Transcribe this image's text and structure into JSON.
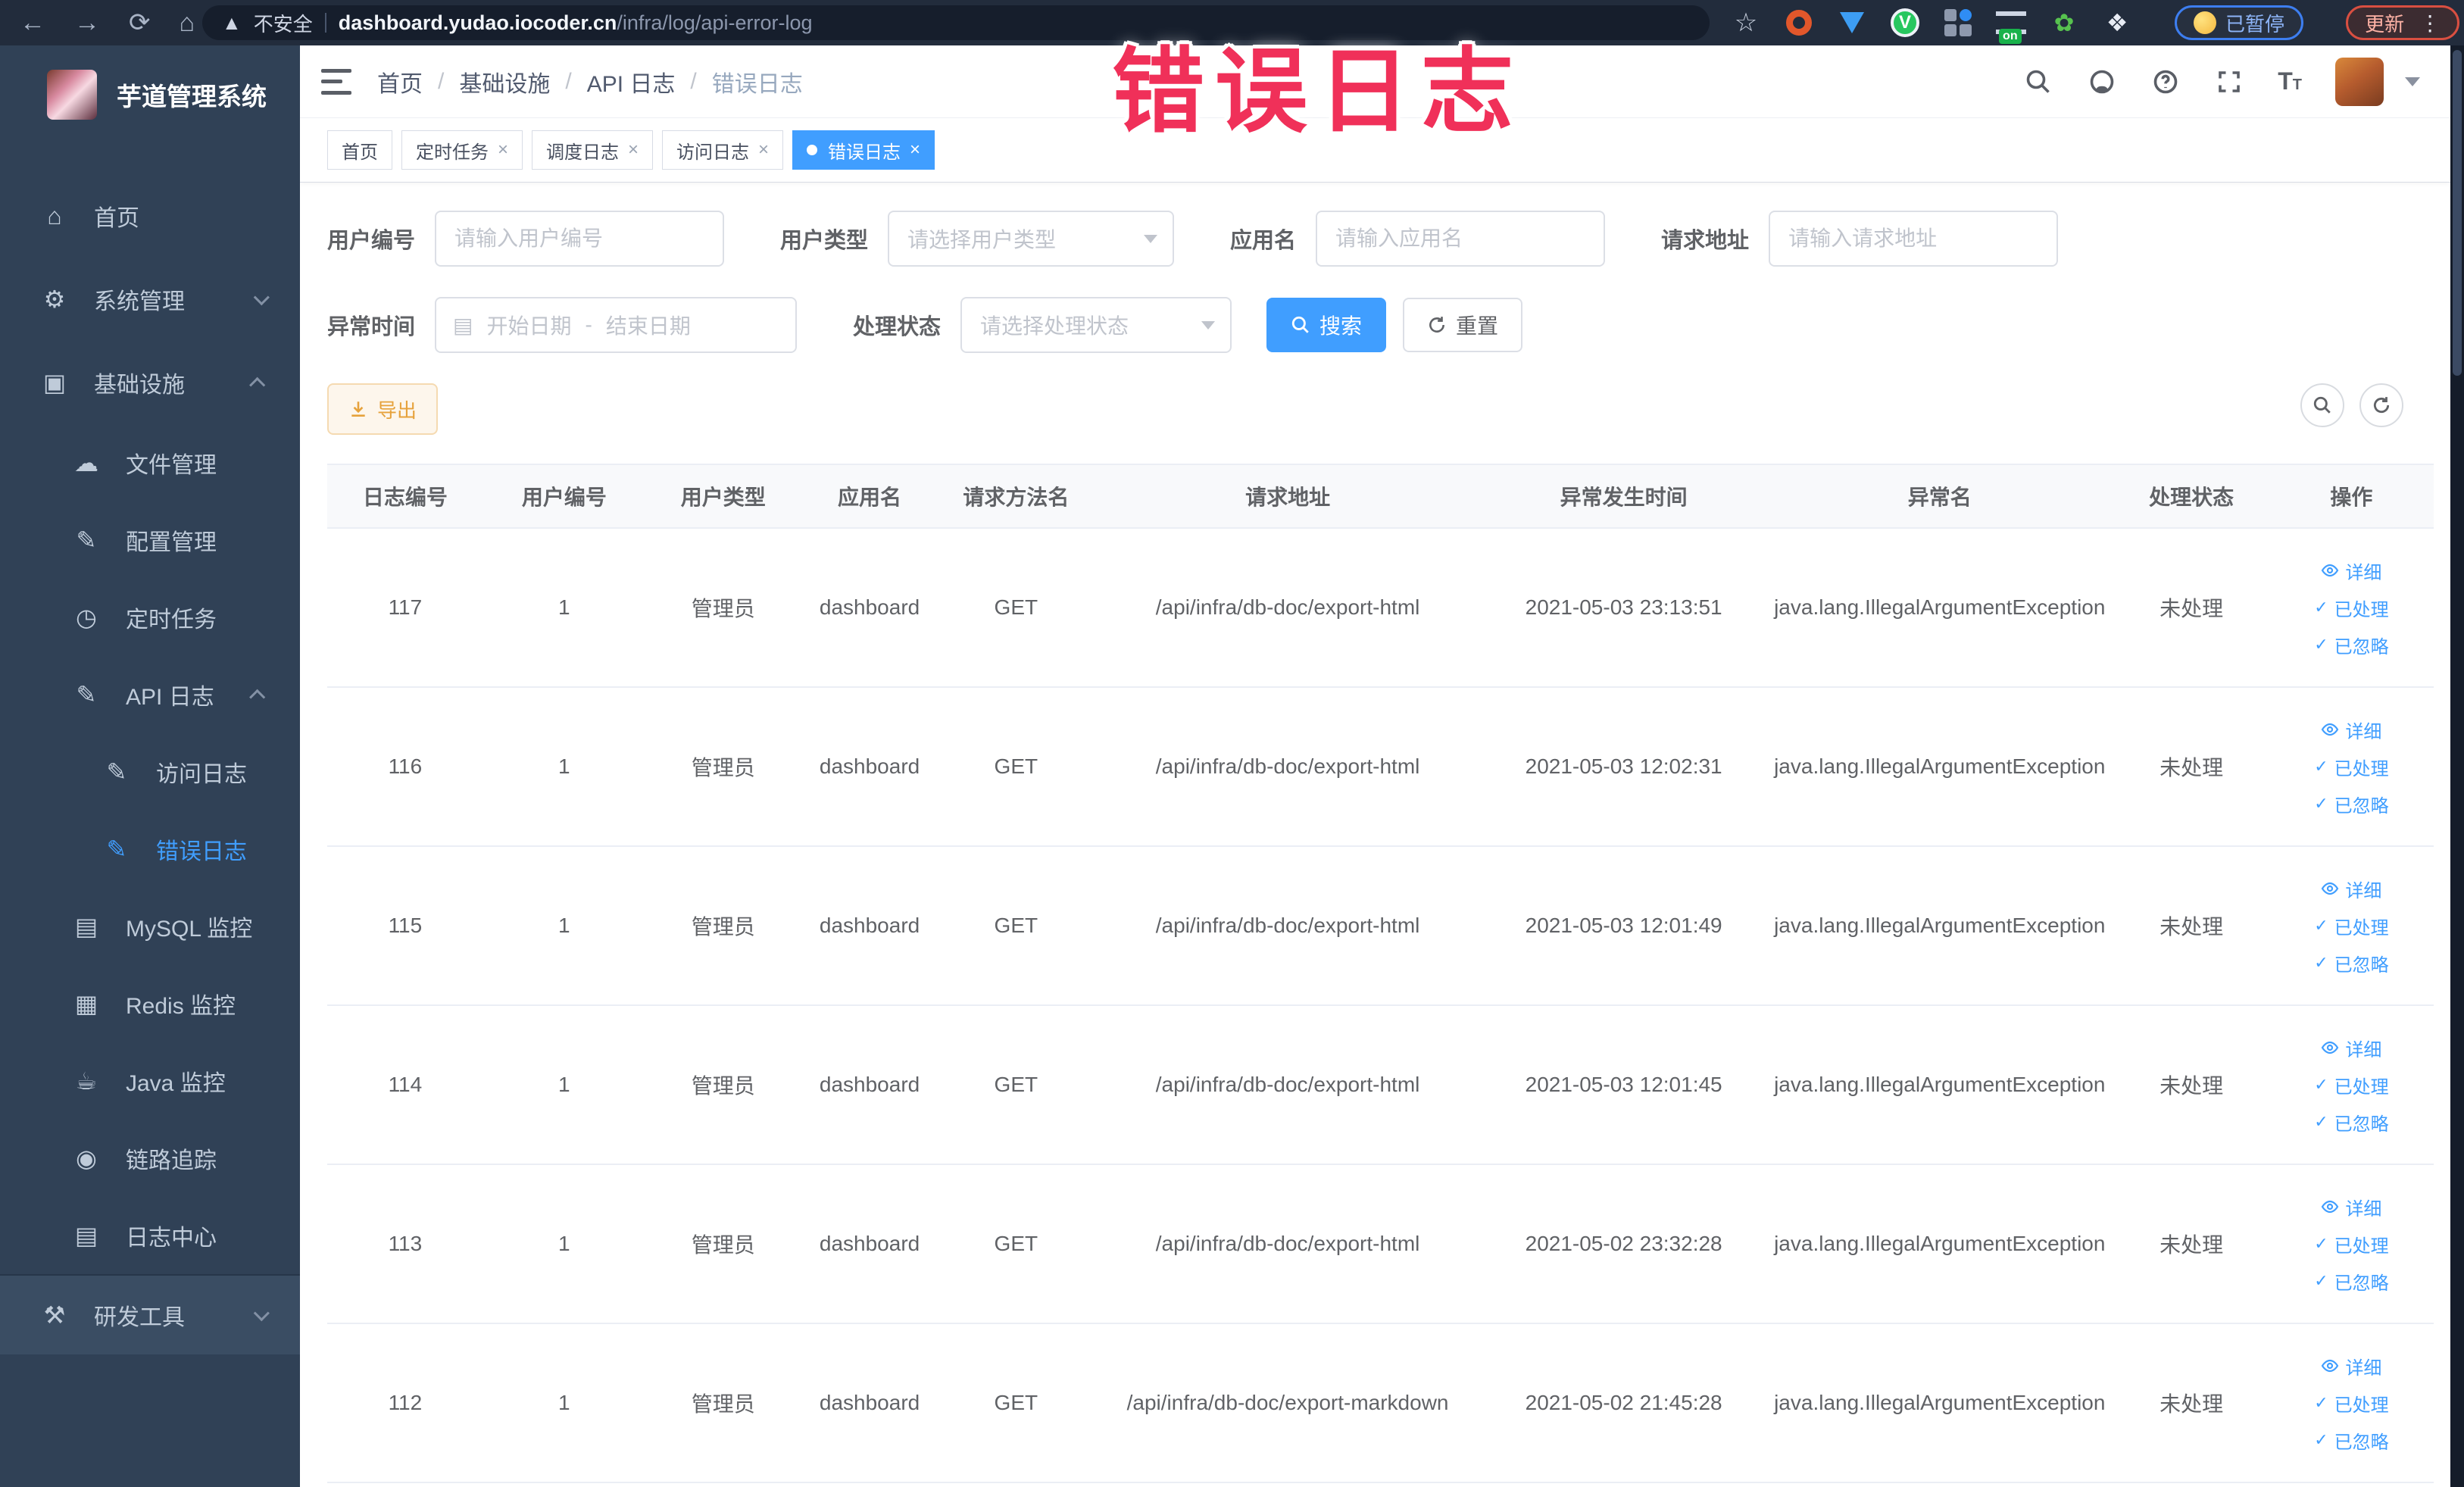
{
  "annotation": {
    "text": "错误日志"
  },
  "ui": {
    "close": "×",
    "crumb_sep": "/",
    "kebab": "⋮",
    "grid_v": "V",
    "on_badge": "on"
  },
  "browser": {
    "security_label": "不安全",
    "url_domain": "dashboard.yudao.iocoder.cn",
    "url_path": "/infra/log/api-error-log",
    "paused_badge": "已暂停",
    "update_badge": "更新"
  },
  "sidebar": {
    "title": "芋道管理系统",
    "menu": [
      {
        "label": "首页"
      },
      {
        "label": "系统管理"
      },
      {
        "label": "基础设施"
      },
      {
        "label": "文件管理"
      },
      {
        "label": "配置管理"
      },
      {
        "label": "定时任务"
      },
      {
        "label": "API 日志"
      },
      {
        "label": "访问日志"
      },
      {
        "label": "错误日志"
      },
      {
        "label": "MySQL 监控"
      },
      {
        "label": "Redis 监控"
      },
      {
        "label": "Java 监控"
      },
      {
        "label": "链路追踪"
      },
      {
        "label": "日志中心"
      },
      {
        "label": "研发工具"
      }
    ]
  },
  "navbar": {
    "breadcrumb": [
      "首页",
      "基础设施",
      "API 日志",
      "错误日志"
    ]
  },
  "tabs": [
    {
      "label": "首页"
    },
    {
      "label": "定时任务"
    },
    {
      "label": "调度日志"
    },
    {
      "label": "访问日志"
    },
    {
      "label": "错误日志"
    }
  ],
  "filters": {
    "user_id_label": "用户编号",
    "user_id_placeholder": "请输入用户编号",
    "user_type_label": "用户类型",
    "user_type_placeholder": "请选择用户类型",
    "app_name_label": "应用名",
    "app_name_placeholder": "请输入应用名",
    "request_url_label": "请求地址",
    "request_url_placeholder": "请输入请求地址",
    "exception_time_label": "异常时间",
    "date_start_placeholder": "开始日期",
    "date_separator": "-",
    "date_end_placeholder": "结束日期",
    "process_status_label": "处理状态",
    "process_status_placeholder": "请选择处理状态",
    "search_button": "搜索",
    "reset_button": "重置"
  },
  "toolbar": {
    "export_button": "导出"
  },
  "table": {
    "columns": [
      "日志编号",
      "用户编号",
      "用户类型",
      "应用名",
      "请求方法名",
      "请求地址",
      "异常发生时间",
      "异常名",
      "处理状态",
      "操作"
    ],
    "actions": {
      "detail": "详细",
      "processed": "已处理",
      "ignored": "已忽略"
    },
    "rows": [
      {
        "id": "117",
        "user_id": "1",
        "user_type": "管理员",
        "app": "dashboard",
        "method": "GET",
        "url": "/api/infra/db-doc/export-html",
        "time": "2021-05-03 23:13:51",
        "exception": "java.lang.IllegalArgumentException",
        "status": "未处理"
      },
      {
        "id": "116",
        "user_id": "1",
        "user_type": "管理员",
        "app": "dashboard",
        "method": "GET",
        "url": "/api/infra/db-doc/export-html",
        "time": "2021-05-03 12:02:31",
        "exception": "java.lang.IllegalArgumentException",
        "status": "未处理"
      },
      {
        "id": "115",
        "user_id": "1",
        "user_type": "管理员",
        "app": "dashboard",
        "method": "GET",
        "url": "/api/infra/db-doc/export-html",
        "time": "2021-05-03 12:01:49",
        "exception": "java.lang.IllegalArgumentException",
        "status": "未处理"
      },
      {
        "id": "114",
        "user_id": "1",
        "user_type": "管理员",
        "app": "dashboard",
        "method": "GET",
        "url": "/api/infra/db-doc/export-html",
        "time": "2021-05-03 12:01:45",
        "exception": "java.lang.IllegalArgumentException",
        "status": "未处理"
      },
      {
        "id": "113",
        "user_id": "1",
        "user_type": "管理员",
        "app": "dashboard",
        "method": "GET",
        "url": "/api/infra/db-doc/export-html",
        "time": "2021-05-02 23:32:28",
        "exception": "java.lang.IllegalArgumentException",
        "status": "未处理"
      },
      {
        "id": "112",
        "user_id": "1",
        "user_type": "管理员",
        "app": "dashboard",
        "method": "GET",
        "url": "/api/infra/db-doc/export-markdown",
        "time": "2021-05-02 21:45:28",
        "exception": "java.lang.IllegalArgumentException",
        "status": "未处理"
      }
    ]
  }
}
